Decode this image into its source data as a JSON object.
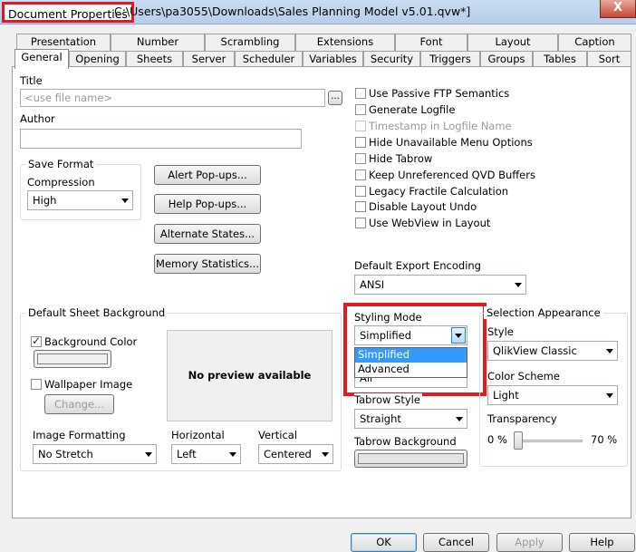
{
  "window": {
    "title_app": "Document Properties",
    "title_path": "C:\\Users\\pa3055\\Downloads\\Sales Planning Model v5.01.qvw*]",
    "close_glyph": "X"
  },
  "tabs_row1": [
    "Presentation",
    "Number",
    "Scrambling",
    "Extensions",
    "Font",
    "Layout",
    "Caption"
  ],
  "tabs_row2": [
    "General",
    "Opening",
    "Sheets",
    "Server",
    "Scheduler",
    "Variables",
    "Security",
    "Triggers",
    "Groups",
    "Tables",
    "Sort"
  ],
  "general": {
    "title_label": "Title",
    "title_placeholder": "<use file name>",
    "title_button": "...",
    "author_label": "Author",
    "author_value": "",
    "save_format": {
      "group_label": "Save Format",
      "compression_label": "Compression",
      "compression_value": "High"
    },
    "buttons": {
      "alert_popups": "Alert Pop-ups...",
      "help_popups": "Help Pop-ups...",
      "alternate_states": "Alternate States...",
      "memory_statistics": "Memory Statistics..."
    },
    "options": [
      {
        "label": "Use Passive FTP Semantics",
        "checked": false,
        "disabled": false
      },
      {
        "label": "Generate Logfile",
        "checked": false,
        "disabled": false
      },
      {
        "label": "Timestamp in Logfile Name",
        "checked": false,
        "disabled": true
      },
      {
        "label": "Hide Unavailable Menu Options",
        "checked": false,
        "disabled": false
      },
      {
        "label": "Hide Tabrow",
        "checked": false,
        "disabled": false
      },
      {
        "label": "Keep Unreferenced QVD Buffers",
        "checked": false,
        "disabled": false
      },
      {
        "label": "Legacy Fractile Calculation",
        "checked": false,
        "disabled": false
      },
      {
        "label": "Disable Layout Undo",
        "checked": false,
        "disabled": false
      },
      {
        "label": "Use WebView in Layout",
        "checked": false,
        "disabled": false
      }
    ],
    "export_encoding": {
      "label": "Default Export Encoding",
      "value": "ANSI"
    },
    "sheet_background": {
      "group_label": "Default Sheet Background",
      "background_color_label": "Background Color",
      "background_color_checked": true,
      "wallpaper_label": "Wallpaper Image",
      "wallpaper_checked": false,
      "change_button": "Change...",
      "preview_text": "No preview available",
      "image_formatting_label": "Image Formatting",
      "image_formatting_value": "No Stretch",
      "horizontal_label": "Horizontal",
      "horizontal_value": "Left",
      "vertical_label": "Vertical",
      "vertical_value": "Centered"
    },
    "styling_mode": {
      "label": "Styling Mode",
      "value": "Simplified",
      "options": [
        "Simplified",
        "Advanced"
      ],
      "hidden_partial": "All"
    },
    "tabrow_style": {
      "label": "Tabrow Style",
      "value": "Straight"
    },
    "tabrow_background_label": "Tabrow Background",
    "selection_appearance": {
      "group_label": "Selection Appearance",
      "style_label": "Style",
      "style_value": "QlikView Classic",
      "color_scheme_label": "Color Scheme",
      "color_scheme_value": "Light",
      "transparency_label": "Transparency",
      "transparency_min": "0 %",
      "transparency_max": "70 %",
      "transparency_level": 0
    }
  },
  "footer": {
    "ok": "OK",
    "cancel": "Cancel",
    "apply": "Apply",
    "help": "Help"
  },
  "colors": {
    "highlight": "#e01b22",
    "selection": "#3399ff"
  }
}
